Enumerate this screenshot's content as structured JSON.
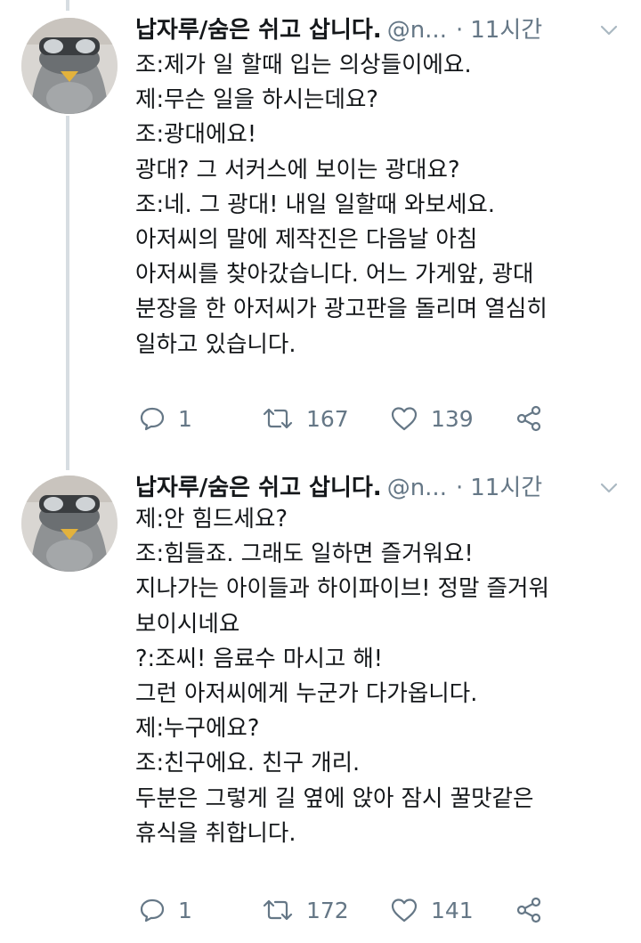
{
  "tweets": [
    {
      "display_name": "납자루/숨은 쉬고 삽니다.",
      "handle": "@n...",
      "separator": "·",
      "time": "11시간",
      "lines": [
        "조:제가 일 할때 입는 의상들이에요.",
        "제:무슨 일을 하시는데요?",
        "조:광대에요!",
        "광대? 그 서커스에 보이는 광대요?",
        "조:네. 그 광대! 내일 일할때 와보세요.",
        "아저씨의 말에 제작진은 다음날 아침",
        "아저씨를 찾아갔습니다. 어느 가게앞, 광대",
        "분장을 한 아저씨가 광고판을 돌리며 열심히",
        "일하고 있습니다."
      ],
      "reply_count": "1",
      "retweet_count": "167",
      "like_count": "139"
    },
    {
      "display_name": "납자루/숨은 쉬고 삽니다.",
      "handle": "@n...",
      "separator": "·",
      "time": "11시간",
      "lines": [
        "제:안 힘드세요?",
        "조:힘들죠. 그래도 일하면 즐거워요!",
        "지나가는 아이들과 하이파이브! 정말 즐거워",
        "보이시네요",
        "?:조씨! 음료수 마시고 해!",
        "그런 아저씨에게 누군가 다가옵니다.",
        "제:누구에요?",
        "조:친구에요. 친구 개리.",
        "두분은 그렇게 길 옆에 앉아 잠시 꿀맛같은",
        "휴식을 취합니다."
      ],
      "reply_count": "1",
      "retweet_count": "172",
      "like_count": "141"
    }
  ],
  "icons": {
    "reply": "reply-icon",
    "retweet": "retweet-icon",
    "like": "heart-icon",
    "share": "share-icon",
    "menu": "chevron-down-icon"
  },
  "colors": {
    "text": "#14171a",
    "secondary": "#657786",
    "thread_line": "#d7dde2"
  }
}
